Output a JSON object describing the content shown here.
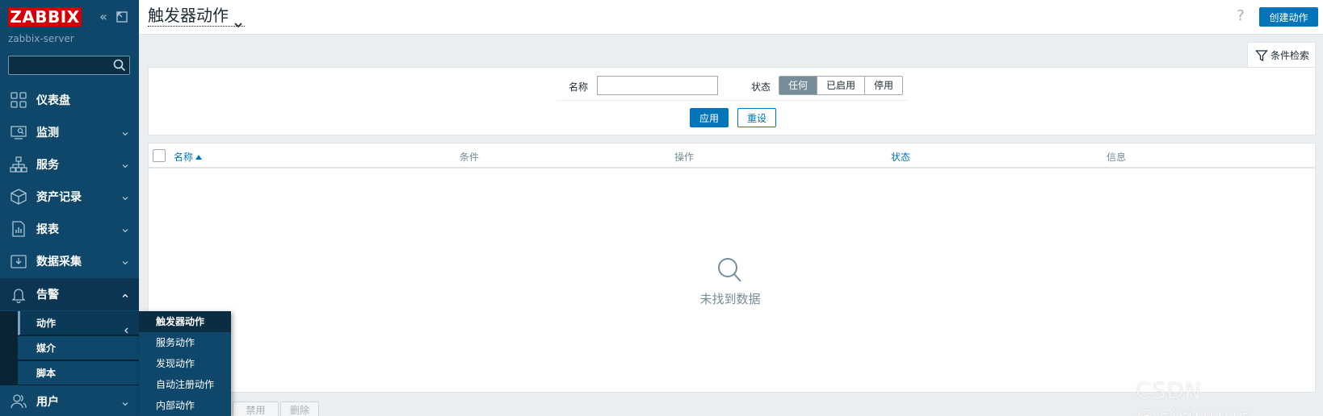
{
  "brand": {
    "logo_text": "ZABBIX",
    "server_name": "zabbix-server",
    "color": "#d40000"
  },
  "sidebar": {
    "search_placeholder": "",
    "items": [
      {
        "label": "仪表盘",
        "icon": "dashboard-icon"
      },
      {
        "label": "监测",
        "icon": "monitoring-icon"
      },
      {
        "label": "服务",
        "icon": "services-icon"
      },
      {
        "label": "资产记录",
        "icon": "inventory-icon"
      },
      {
        "label": "报表",
        "icon": "reports-icon"
      },
      {
        "label": "数据采集",
        "icon": "data-collection-icon"
      },
      {
        "label": "告警",
        "icon": "alerts-icon"
      },
      {
        "label": "用户",
        "icon": "users-icon"
      }
    ],
    "alerts_sub": [
      "动作",
      "媒介",
      "脚本"
    ],
    "actions_flyout": [
      "触发器动作",
      "服务动作",
      "发现动作",
      "自动注册动作",
      "内部动作"
    ]
  },
  "header": {
    "title": "触发器动作",
    "help": "?",
    "create_label": "创建动作"
  },
  "filter": {
    "tab_label": "条件检索",
    "name_label": "名称",
    "name_value": "",
    "status_label": "状态",
    "status_options": [
      "任何",
      "已启用",
      "停用"
    ],
    "status_selected": "任何",
    "apply_label": "应用",
    "reset_label": "重设"
  },
  "table": {
    "columns": [
      "名称",
      "条件",
      "操作",
      "状态",
      "信息"
    ],
    "empty_text": "未找到数据"
  },
  "footer": {
    "buttons": [
      "禁用",
      "删除"
    ]
  },
  "watermark": "CSDN @siriuuus",
  "colors": {
    "sidebar_bg": "#0e4769",
    "primary": "#0275b8",
    "page_bg": "#ebeef0"
  }
}
